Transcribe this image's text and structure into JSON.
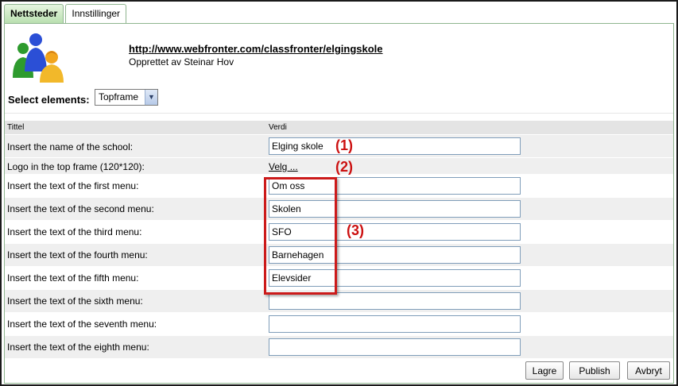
{
  "tabs": [
    {
      "label": "Nettsteder",
      "active": true
    },
    {
      "label": "Innstillinger",
      "active": false
    }
  ],
  "header": {
    "logo_icon": "users-icon",
    "site_url": "http://www.webfronter.com/classfronter/elgingskole",
    "created_by": "Opprettet av Steinar Hov"
  },
  "select": {
    "label": "Select elements:",
    "value": "Topframe"
  },
  "table": {
    "col_title": "Tittel",
    "col_value": "Verdi",
    "rows": [
      {
        "label": "Insert the name of the school:",
        "value": "Elging skole"
      },
      {
        "label": "Logo in the top frame (120*120):",
        "value": "Velg ..."
      },
      {
        "label": "Insert the text of the first menu:",
        "value": "Om oss"
      },
      {
        "label": "Insert the text of the second menu:",
        "value": "Skolen"
      },
      {
        "label": "Insert the text of the third menu:",
        "value": "SFO"
      },
      {
        "label": "Insert the text of the fourth menu:",
        "value": "Barnehagen"
      },
      {
        "label": "Insert the text of the fifth menu:",
        "value": "Elevsider"
      },
      {
        "label": "Insert the text of the sixth menu:",
        "value": ""
      },
      {
        "label": "Insert the text of the seventh menu:",
        "value": ""
      },
      {
        "label": "Insert the text of the eighth menu:",
        "value": ""
      }
    ]
  },
  "annotations": {
    "a1": "(1)",
    "a2": "(2)",
    "a3": "(3)",
    "color": "#cc1111"
  },
  "buttons": {
    "save": "Lagre",
    "publish": "Publish",
    "cancel": "Avbryt"
  }
}
